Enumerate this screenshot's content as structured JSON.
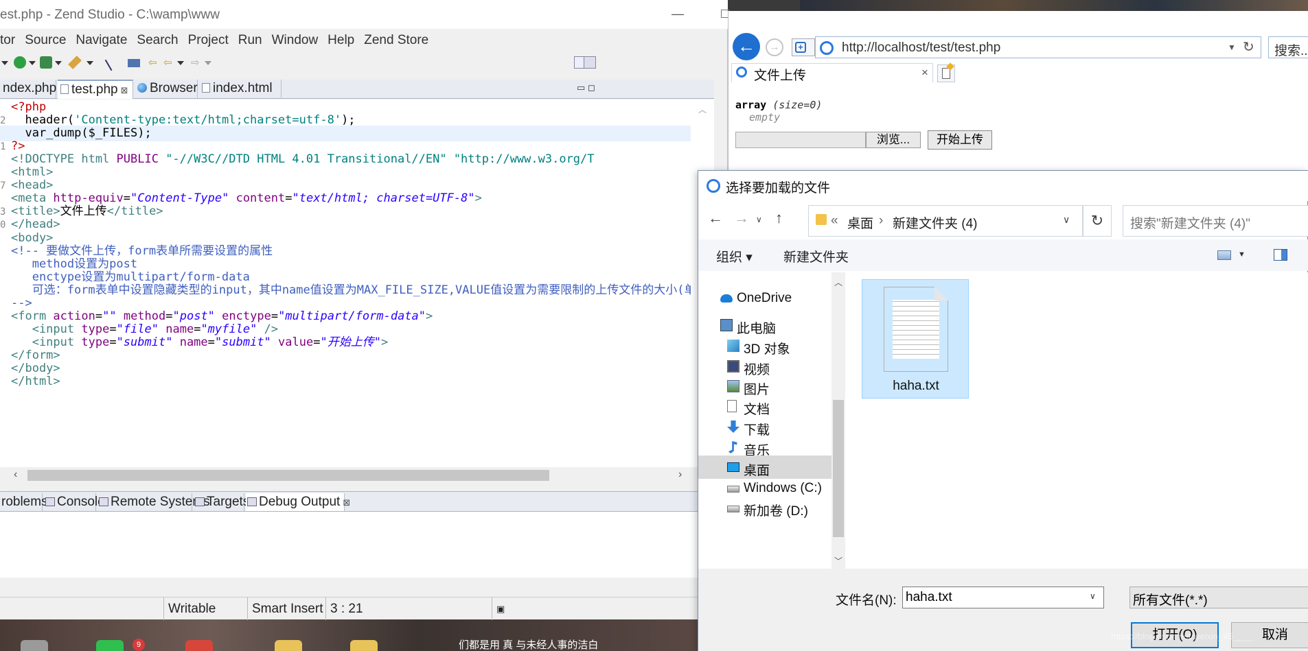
{
  "zend": {
    "title": "est.php - Zend Studio - C:\\wamp\\www",
    "menu": [
      "tor",
      "Source",
      "Navigate",
      "Search",
      "Project",
      "Run",
      "Window",
      "Help",
      "Zend Store"
    ],
    "editor_tabs": [
      {
        "label": "ndex.php"
      },
      {
        "label": "test.php",
        "close": "⊠"
      },
      {
        "label": "Browser"
      },
      {
        "label": "index.html"
      }
    ],
    "code": [
      {
        "ln": "",
        "parts": [
          {
            "c": "php",
            "t": "<?php"
          }
        ]
      },
      {
        "ln": "2",
        "parts": [
          {
            "c": "txt",
            "t": "  header("
          },
          {
            "c": "str",
            "t": "'Content-type:text/html;charset=utf-8'"
          },
          {
            "c": "txt",
            "t": ");"
          }
        ]
      },
      {
        "ln": "",
        "hl": true,
        "parts": [
          {
            "c": "txt",
            "t": "  var_dump($_FILES);"
          }
        ]
      },
      {
        "ln": "1",
        "parts": [
          {
            "c": "php",
            "t": "?>"
          }
        ]
      },
      {
        "ln": "",
        "parts": [
          {
            "c": "doc",
            "t": "<!DOCTYPE html "
          },
          {
            "c": "attr",
            "t": "PUBLIC"
          },
          {
            "c": "str",
            "t": " \"-//W3C//DTD HTML 4.01 Transitional//EN\" \"http://www.w3.org/T"
          }
        ]
      },
      {
        "ln": "",
        "parts": [
          {
            "c": "tag",
            "t": "<html>"
          }
        ]
      },
      {
        "ln": "7",
        "parts": [
          {
            "c": "tag",
            "t": "<head>"
          }
        ]
      },
      {
        "ln": "",
        "parts": [
          {
            "c": "tag",
            "t": "<meta "
          },
          {
            "c": "attr",
            "t": "http-equiv"
          },
          {
            "c": "txt",
            "t": "="
          },
          {
            "c": "val",
            "t": "\"Content-Type\""
          },
          {
            "c": "txt",
            "t": " "
          },
          {
            "c": "attr",
            "t": "content"
          },
          {
            "c": "txt",
            "t": "="
          },
          {
            "c": "val",
            "t": "\"text/html; charset=UTF-8\""
          },
          {
            "c": "tag",
            "t": ">"
          }
        ]
      },
      {
        "ln": "3",
        "parts": [
          {
            "c": "tag",
            "t": "<title>"
          },
          {
            "c": "txt",
            "t": "文件上传"
          },
          {
            "c": "tag",
            "t": "</title>"
          }
        ]
      },
      {
        "ln": "0",
        "parts": [
          {
            "c": "tag",
            "t": "</head>"
          }
        ]
      },
      {
        "ln": "",
        "parts": [
          {
            "c": "tag",
            "t": "<body>"
          }
        ]
      },
      {
        "ln": "",
        "parts": [
          {
            "c": "cmt",
            "t": "<!-- 要做文件上传，form表单所需要设置的属性"
          }
        ]
      },
      {
        "ln": "",
        "parts": [
          {
            "c": "cmt",
            "t": "   method设置为post"
          }
        ]
      },
      {
        "ln": "",
        "parts": [
          {
            "c": "cmt",
            "t": "   enctype设置为multipart/form-data"
          }
        ]
      },
      {
        "ln": "",
        "parts": [
          {
            "c": "cmt",
            "t": "   可选：form表单中设置隐藏类型的input，其中name值设置为MAX_FILE_SIZE,VALUE值设置为需要限制的上传文件的大小(单位"
          }
        ]
      },
      {
        "ln": "",
        "parts": [
          {
            "c": "cmt",
            "t": "-->"
          }
        ]
      },
      {
        "ln": "",
        "parts": [
          {
            "c": "tag",
            "t": "<form "
          },
          {
            "c": "attr",
            "t": "action"
          },
          {
            "c": "txt",
            "t": "="
          },
          {
            "c": "val",
            "t": "\"\""
          },
          {
            "c": "txt",
            "t": " "
          },
          {
            "c": "attr",
            "t": "method"
          },
          {
            "c": "txt",
            "t": "="
          },
          {
            "c": "val",
            "t": "\"post\""
          },
          {
            "c": "txt",
            "t": " "
          },
          {
            "c": "attr",
            "t": "enctype"
          },
          {
            "c": "txt",
            "t": "="
          },
          {
            "c": "val",
            "t": "\"multipart/form-data\""
          },
          {
            "c": "tag",
            "t": ">"
          }
        ]
      },
      {
        "ln": "",
        "parts": [
          {
            "c": "tag",
            "t": "   <input "
          },
          {
            "c": "attr",
            "t": "type"
          },
          {
            "c": "txt",
            "t": "="
          },
          {
            "c": "val",
            "t": "\"file\""
          },
          {
            "c": "txt",
            "t": " "
          },
          {
            "c": "attr",
            "t": "name"
          },
          {
            "c": "txt",
            "t": "="
          },
          {
            "c": "val",
            "t": "\"myfile\""
          },
          {
            "c": "tag",
            "t": " />"
          }
        ]
      },
      {
        "ln": "",
        "parts": [
          {
            "c": "tag",
            "t": "   <input "
          },
          {
            "c": "attr",
            "t": "type"
          },
          {
            "c": "txt",
            "t": "="
          },
          {
            "c": "val",
            "t": "\"submit\""
          },
          {
            "c": "txt",
            "t": " "
          },
          {
            "c": "attr",
            "t": "name"
          },
          {
            "c": "txt",
            "t": "="
          },
          {
            "c": "val",
            "t": "\"submit\""
          },
          {
            "c": "txt",
            "t": " "
          },
          {
            "c": "attr",
            "t": "value"
          },
          {
            "c": "txt",
            "t": "="
          },
          {
            "c": "val",
            "t": "\"开始上传\""
          },
          {
            "c": "tag",
            "t": ">"
          }
        ]
      },
      {
        "ln": "",
        "parts": [
          {
            "c": "tag",
            "t": "</form>"
          }
        ]
      },
      {
        "ln": "",
        "parts": [
          {
            "c": "tag",
            "t": "</body>"
          }
        ]
      },
      {
        "ln": "",
        "parts": [
          {
            "c": "tag",
            "t": "</html>"
          }
        ]
      }
    ],
    "bottom_tabs": [
      {
        "label": "roblems"
      },
      {
        "label": "Console"
      },
      {
        "label": "Remote Systems"
      },
      {
        "label": "Targets"
      },
      {
        "label": "Debug Output",
        "close": "⊠"
      }
    ],
    "status": {
      "writable": "Writable",
      "insert": "Smart Insert",
      "position": "3 : 21"
    }
  },
  "ie": {
    "url": "http://localhost/test/test.php",
    "search_placeholder": "搜索...",
    "tab_title": "文件上传",
    "tab_close": "×",
    "vardump_keyword": "array",
    "vardump_size": "(size=0)",
    "vardump_empty": "empty",
    "browse_label": "浏览...",
    "upload_label": "开始上传"
  },
  "dialog": {
    "title": "选择要加载的文件",
    "breadcrumb_prefix": "«",
    "breadcrumb": [
      "桌面",
      "新建文件夹 (4)"
    ],
    "breadcrumb_sep": "›",
    "search_placeholder": "搜索\"新建文件夹 (4)\"",
    "organize": "组织 ▾",
    "new_folder": "新建文件夹",
    "nav_items": [
      {
        "label": "OneDrive",
        "icon": "cloud"
      },
      {
        "label": "此电脑",
        "icon": "computer"
      },
      {
        "label": "3D 对象",
        "icon": "cube"
      },
      {
        "label": "视频",
        "icon": "video"
      },
      {
        "label": "图片",
        "icon": "picture"
      },
      {
        "label": "文档",
        "icon": "document"
      },
      {
        "label": "下载",
        "icon": "download"
      },
      {
        "label": "音乐",
        "icon": "music"
      },
      {
        "label": "桌面",
        "icon": "desktop",
        "selected": true
      },
      {
        "label": "Windows (C:)",
        "icon": "drive"
      },
      {
        "label": "新加卷 (D:)",
        "icon": "drive"
      }
    ],
    "file": {
      "name": "haha.txt"
    },
    "filename_label": "文件名(N):",
    "filename_value": "haha.txt",
    "filetype": "所有文件(*.*)",
    "open_label": "打开(O)",
    "cancel_label": "取消"
  },
  "taskbar": {
    "badge": "9",
    "caption": "们都是用  真 与未经人事的洁白"
  },
  "watermark": "https://blog.csdn.net/weixin_45____"
}
